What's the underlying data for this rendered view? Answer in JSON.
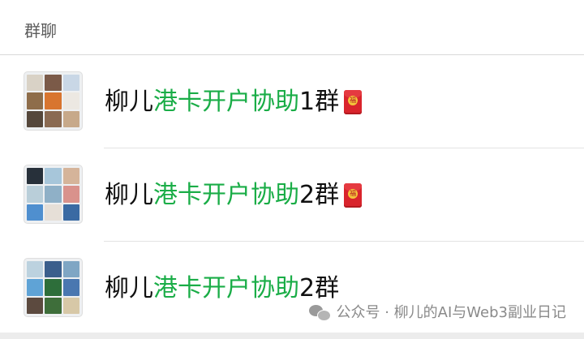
{
  "section": {
    "title": "群聊"
  },
  "chats": [
    {
      "prefix": "柳儿",
      "highlight": "港卡开户协助",
      "suffix": "1群",
      "has_redpacket": true,
      "avatar_tiles": [
        "#d9d2c6",
        "#7b5a48",
        "#c9d7e6",
        "#8e6d4a",
        "#d8752f",
        "#ece8e2",
        "#55473b",
        "#8a6a52",
        "#c7a98a"
      ]
    },
    {
      "prefix": "柳儿",
      "highlight": "港卡开户协助",
      "suffix": "2群",
      "has_redpacket": true,
      "avatar_tiles": [
        "#27303a",
        "#a7c6da",
        "#d5b49a",
        "#b9ced9",
        "#8fb0c7",
        "#d9928c",
        "#4f8fcf",
        "#e6dfd7",
        "#3a6aa3"
      ]
    },
    {
      "prefix": "柳儿",
      "highlight": "港卡开户协助",
      "suffix": "2群",
      "has_redpacket": false,
      "avatar_tiles": [
        "#bcd2df",
        "#3b5f8c",
        "#7fa6c4",
        "#5fa3d6",
        "#2d6e3a",
        "#4a77b0",
        "#5c4a3f",
        "#3e6e3a",
        "#d7c8a7"
      ]
    }
  ],
  "redpacket_glyph": "福",
  "watermark": {
    "icon": "wechat-icon",
    "text": "公众号 · 柳儿的AI与Web3副业日记"
  }
}
